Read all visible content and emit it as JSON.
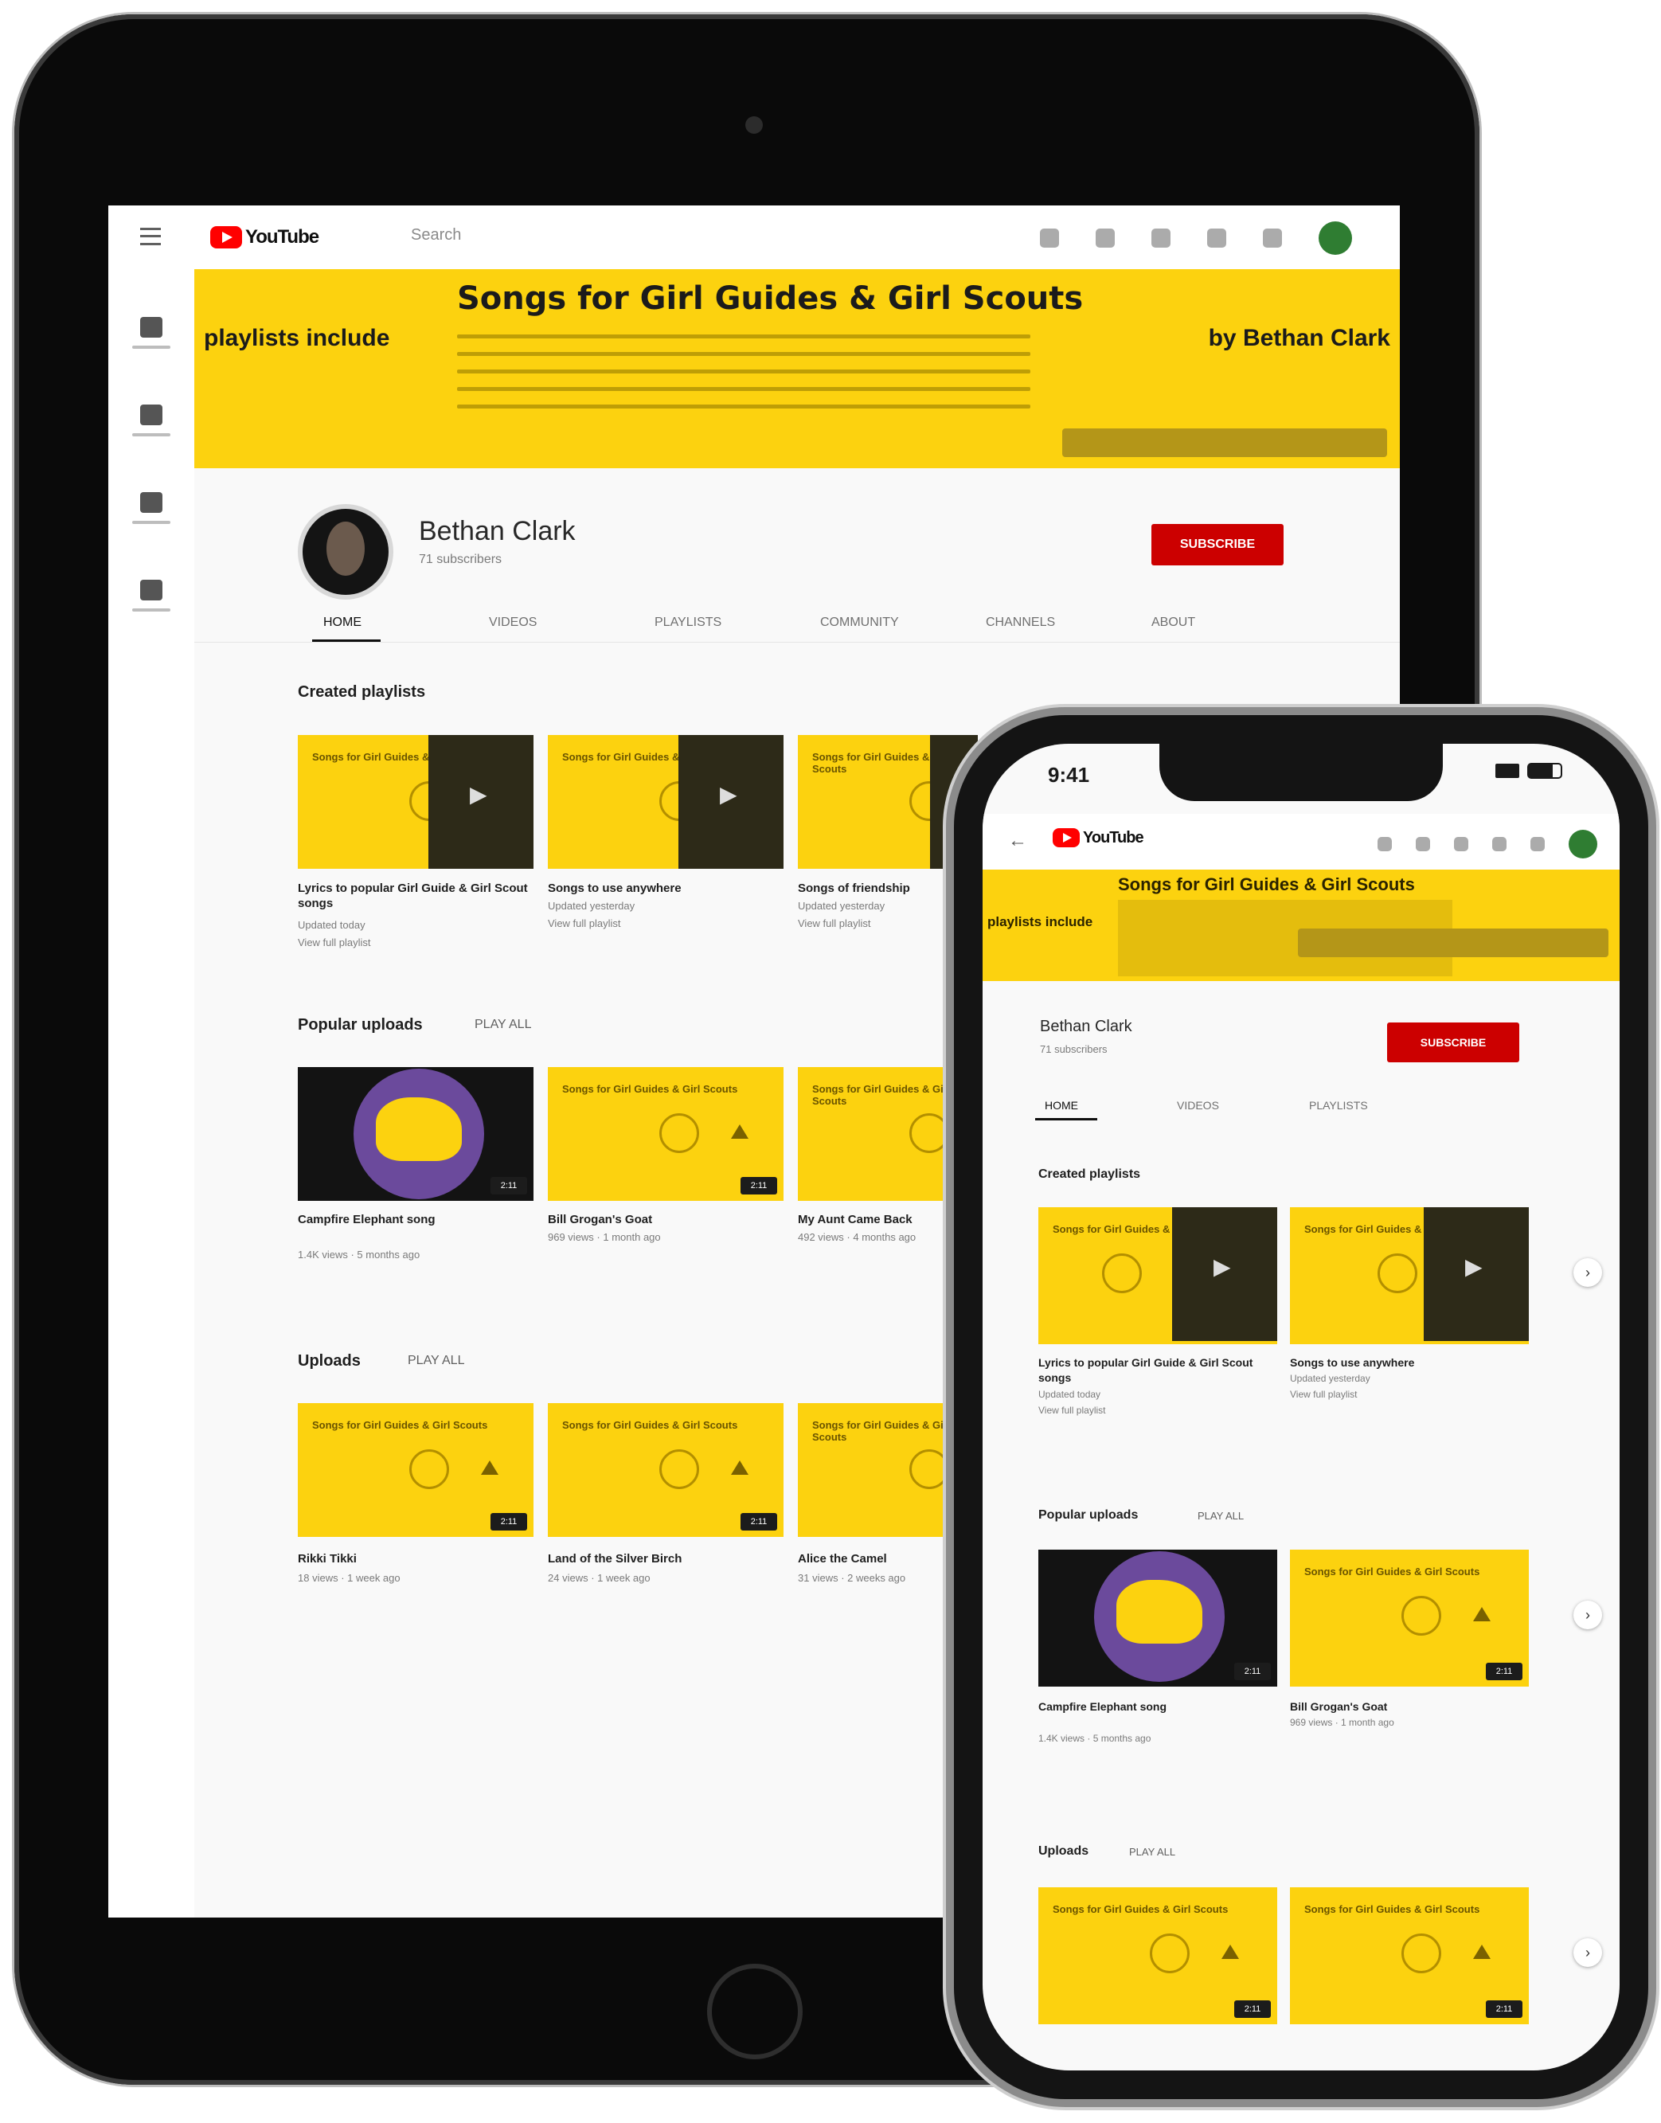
{
  "app": {
    "logo_text": "YouTube"
  },
  "tablet": {
    "search_placeholder": "Search",
    "banner": {
      "title": "Songs for Girl Guides & Girl Scouts",
      "left_text": "playlists include",
      "right_text": "by Bethan Clark"
    },
    "channel": {
      "name": "Bethan Clark",
      "subscribers": "71 subscribers",
      "subscribe_label": "SUBSCRIBE"
    },
    "tabs": [
      "HOME",
      "VIDEOS",
      "PLAYLISTS",
      "COMMUNITY",
      "CHANNELS",
      "ABOUT"
    ],
    "sections": [
      {
        "title": "Created playlists",
        "play_all": "",
        "videos": [
          {
            "title": "Lyrics to popular Girl Guide & Girl Scout songs",
            "meta1": "Updated today",
            "meta2": "View full playlist"
          },
          {
            "title": "Songs to use anywhere",
            "meta1": "Updated yesterday",
            "meta2": "View full playlist"
          },
          {
            "title": "Songs of friendship",
            "meta1": "Updated yesterday",
            "meta2": "View full playlist"
          }
        ]
      },
      {
        "title": "Popular uploads",
        "play_all": "PLAY ALL",
        "videos": [
          {
            "title": "Campfire Elephant song",
            "meta1": "1.4K views · 5 months ago",
            "meta2": ""
          },
          {
            "title": "Bill Grogan's Goat",
            "meta1": "969 views · 1 month ago",
            "meta2": ""
          },
          {
            "title": "My Aunt Came Back",
            "meta1": "492 views · 4 months ago",
            "meta2": ""
          }
        ]
      },
      {
        "title": "Uploads",
        "play_all": "PLAY ALL",
        "videos": [
          {
            "title": "Rikki Tikki",
            "meta1": "18 views · 1 week ago",
            "meta2": ""
          },
          {
            "title": "Land of the Silver Birch",
            "meta1": "24 views · 1 week ago",
            "meta2": ""
          },
          {
            "title": "Alice the Camel",
            "meta1": "31 views · 2 weeks ago",
            "meta2": ""
          }
        ]
      }
    ],
    "card_label": "Songs for Girl Guides & Girl Scouts",
    "duration_badge": "2:11"
  },
  "phone": {
    "status_time": "9:41",
    "banner": {
      "title": "Songs for Girl Guides & Girl Scouts",
      "left_text": "playlists include"
    },
    "channel": {
      "name": "Bethan Clark",
      "subscribers": "71 subscribers",
      "subscribe_label": "SUBSCRIBE"
    },
    "tabs": [
      "HOME",
      "VIDEOS",
      "PLAYLISTS"
    ],
    "sections": [
      {
        "title": "Created playlists",
        "play_all": "",
        "videos": [
          {
            "title": "Lyrics to popular Girl Guide & Girl Scout songs",
            "meta1": "Updated today",
            "meta2": "View full playlist"
          },
          {
            "title": "Songs to use anywhere",
            "meta1": "Updated yesterday",
            "meta2": "View full playlist"
          }
        ]
      },
      {
        "title": "Popular uploads",
        "play_all": "PLAY ALL",
        "videos": [
          {
            "title": "Campfire Elephant song",
            "meta1": "1.4K views · 5 months ago",
            "meta2": ""
          },
          {
            "title": "Bill Grogan's Goat",
            "meta1": "969 views · 1 month ago",
            "meta2": ""
          }
        ]
      },
      {
        "title": "Uploads",
        "play_all": "PLAY ALL",
        "videos": []
      }
    ]
  },
  "colors": {
    "banner_yellow": "#fcd20f",
    "subscribe_red": "#cc0000",
    "card_dark": "#2d2a18"
  }
}
